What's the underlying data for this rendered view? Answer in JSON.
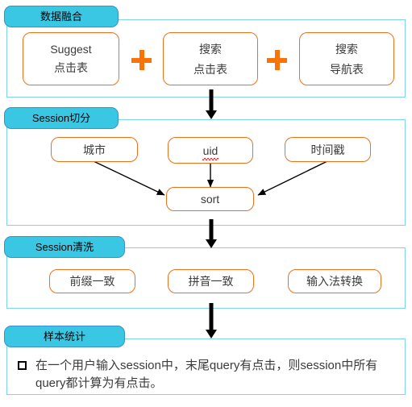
{
  "diagram": {
    "title_text": "数据融合 / Session切分 / Session清洗 / 样本统计 流程图",
    "colors": {
      "tab_fill": "#39c7e3",
      "tab_border": "#3a8fd0",
      "panel_border": "#7ed3f0",
      "node_border": "#e8731c",
      "plus": "#f97306",
      "arrow": "#000000",
      "text": "#3b3b3b",
      "spellcheck": "#e8262a"
    },
    "sections": [
      {
        "id": "data-fusion",
        "tab_label": "数据融合",
        "nodes": [
          {
            "id": "suggest-click-table",
            "line1": "Suggest",
            "line2": "点击表"
          },
          {
            "id": "search-click-table",
            "line1": "搜索",
            "line2": "点击表"
          },
          {
            "id": "search-nav-table",
            "line1": "搜索",
            "line2": "导航表"
          }
        ],
        "operators": [
          "+",
          "+"
        ]
      },
      {
        "id": "session-split",
        "tab_label": "Session切分",
        "nodes": [
          {
            "id": "city",
            "line1": "城市",
            "line2": ""
          },
          {
            "id": "uid",
            "line1": "uid",
            "line2": "",
            "spellcheck": true
          },
          {
            "id": "timestamp",
            "line1": "时间戳",
            "line2": ""
          },
          {
            "id": "sort",
            "line1": "sort",
            "line2": ""
          }
        ]
      },
      {
        "id": "session-clean",
        "tab_label": "Session清洗",
        "nodes": [
          {
            "id": "prefix-match",
            "line1": "前缀一致",
            "line2": ""
          },
          {
            "id": "pinyin-match",
            "line1": "拼音一致",
            "line2": ""
          },
          {
            "id": "ime-convert",
            "line1": "输入法转换",
            "line2": ""
          }
        ]
      },
      {
        "id": "sample-stats",
        "tab_label": "样本统计",
        "bullet": {
          "marker": "hollow-square",
          "text": "在一个用户输入session中，末尾query有点击，则session中所有query都计算为有点击。"
        }
      }
    ],
    "flow_arrows": [
      {
        "id": "fusion-to-split",
        "direction": "down"
      },
      {
        "id": "split-to-clean",
        "direction": "down"
      },
      {
        "id": "clean-to-stats",
        "direction": "down"
      }
    ],
    "inner_arrows": [
      {
        "id": "city-to-sort",
        "from": "city",
        "to": "sort"
      },
      {
        "id": "uid-to-sort",
        "from": "uid",
        "to": "sort"
      },
      {
        "id": "timestamp-to-sort",
        "from": "timestamp",
        "to": "sort"
      }
    ]
  }
}
